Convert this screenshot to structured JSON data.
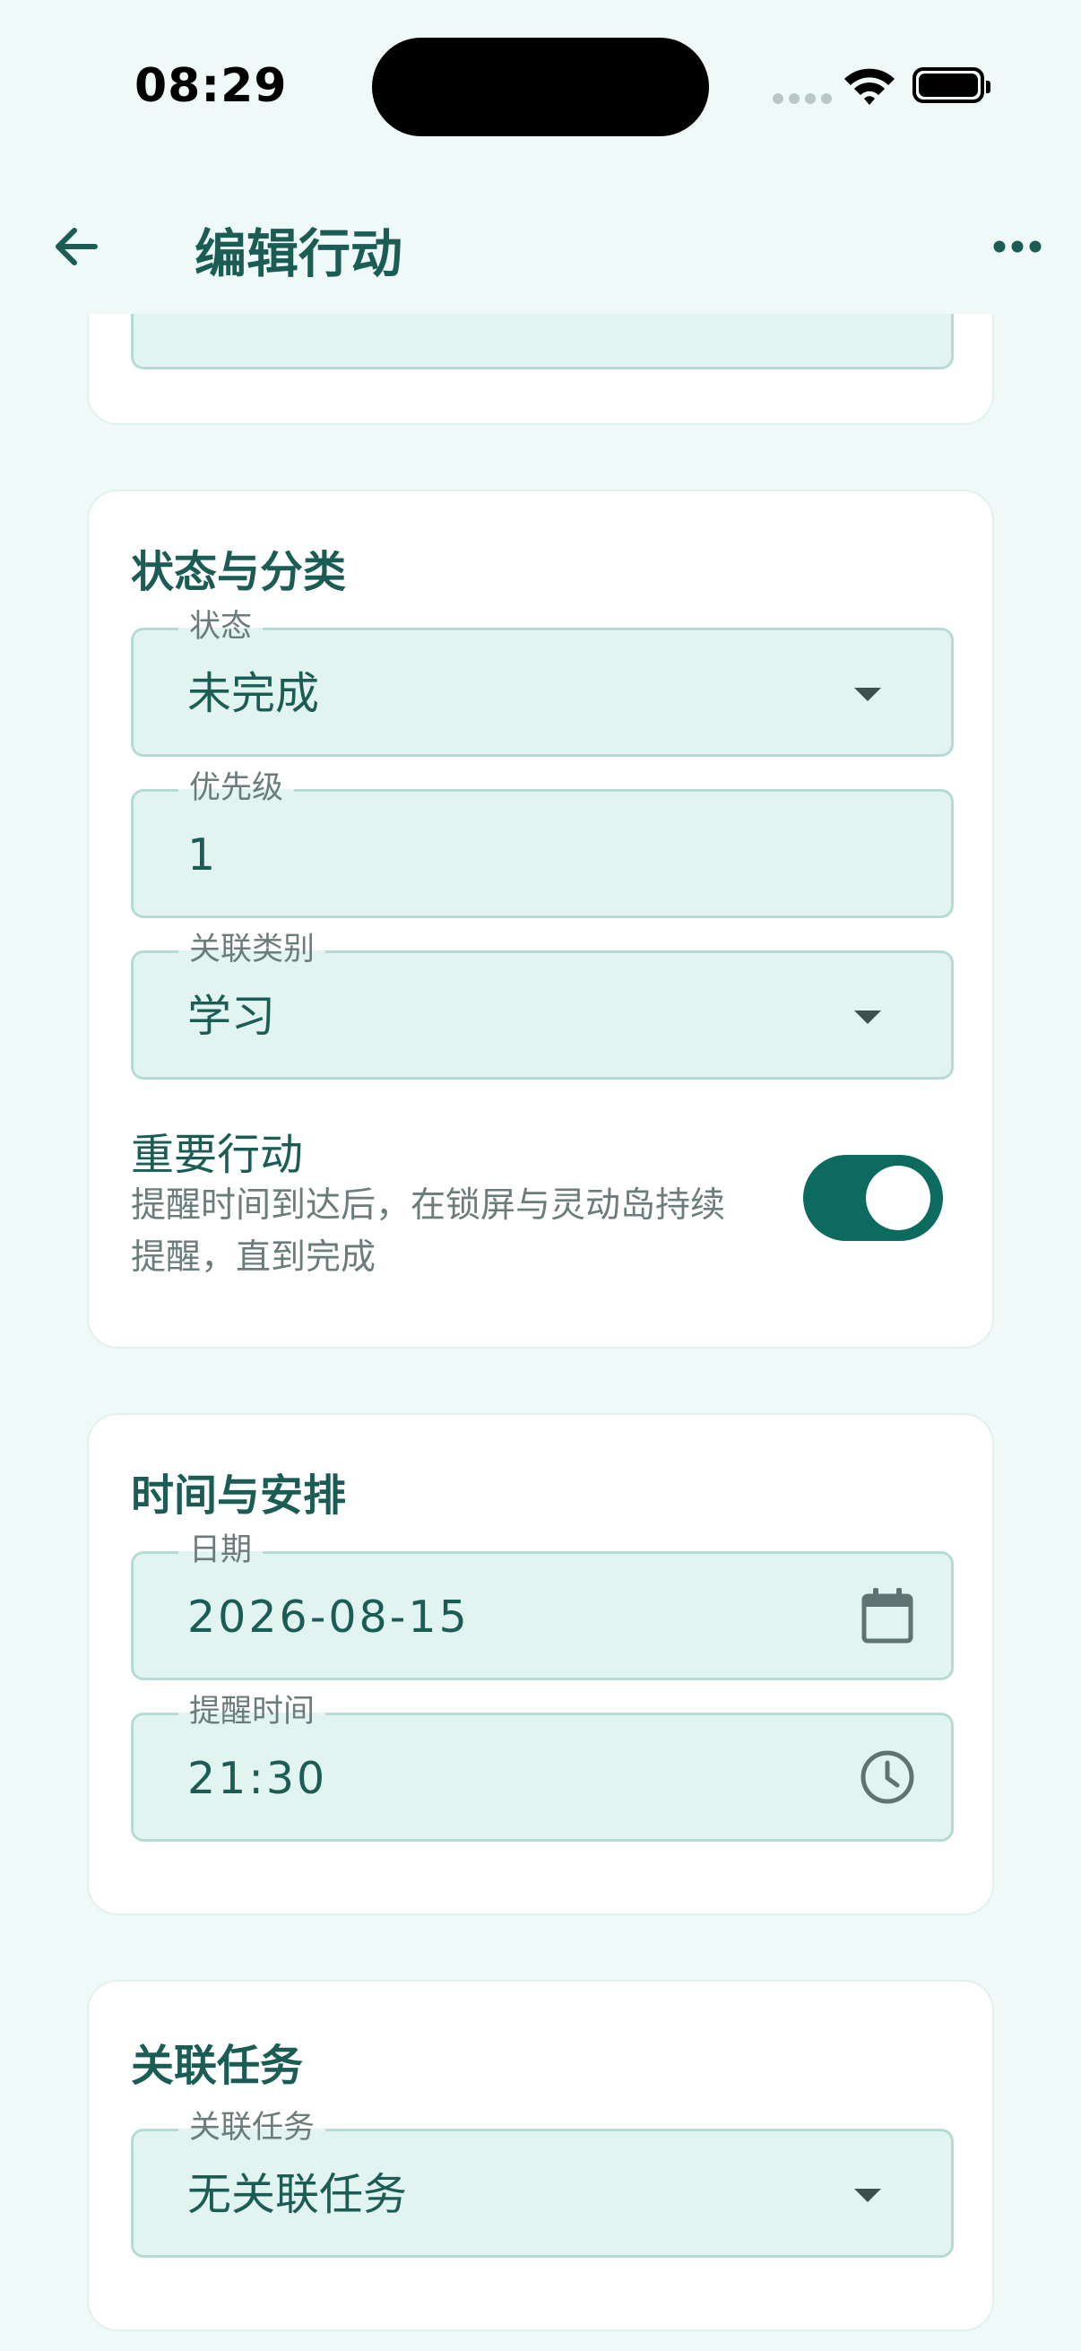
{
  "status_bar": {
    "time": "08:29"
  },
  "header": {
    "title": "编辑行动",
    "back_icon": "arrow-left-icon",
    "more_icon": "more-horizontal-icon"
  },
  "colors": {
    "background": "#effaf8",
    "accent": "#0c6b5e",
    "text_primary": "#1b5c55",
    "text_secondary": "#6b7d7b",
    "field_fill": "#e2f4f0"
  },
  "status_section": {
    "title": "状态与分类",
    "status": {
      "label": "状态",
      "value": "未完成"
    },
    "priority": {
      "label": "优先级",
      "value": "1"
    },
    "category": {
      "label": "关联类别",
      "value": "学习"
    },
    "important": {
      "label": "重要行动",
      "description": "提醒时间到达后，在锁屏与灵动岛持续提醒，直到完成",
      "enabled": true
    }
  },
  "schedule_section": {
    "title": "时间与安排",
    "date": {
      "label": "日期",
      "value": "2026-08-15",
      "icon": "calendar-icon"
    },
    "reminder": {
      "label": "提醒时间",
      "value": "21:30",
      "icon": "clock-icon"
    }
  },
  "task_section": {
    "title": "关联任务",
    "task": {
      "label": "关联任务",
      "value": "无关联任务"
    }
  }
}
